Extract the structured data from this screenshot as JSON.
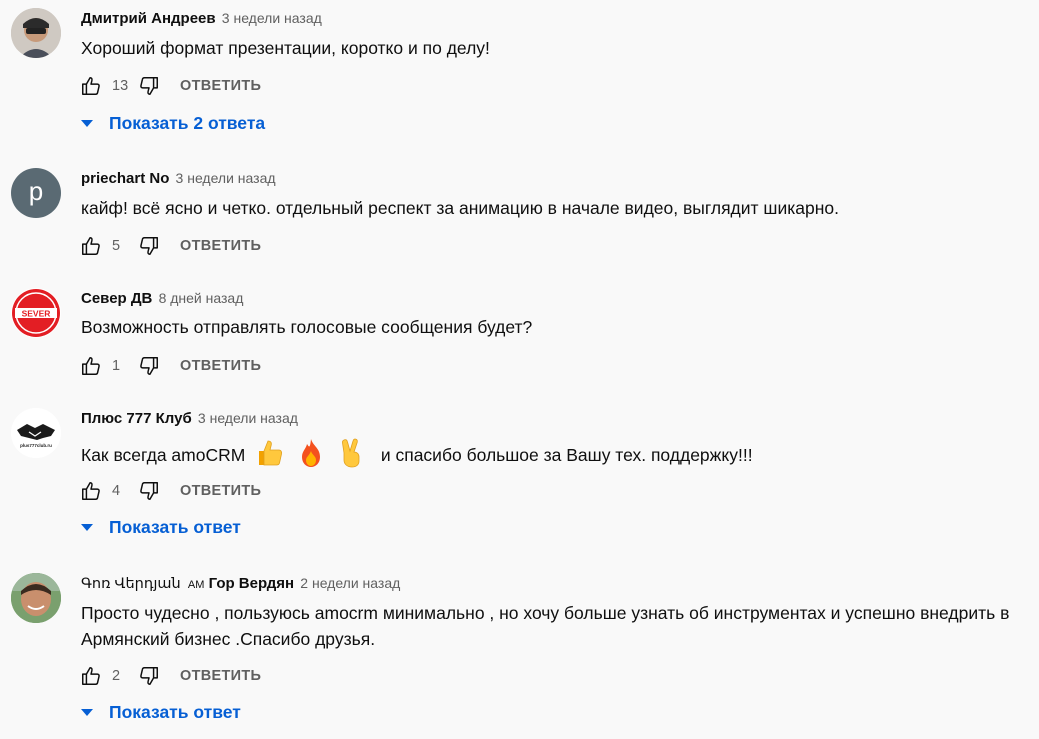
{
  "comments": [
    {
      "author": "Дмитрий Андреев",
      "time": "3 недели назад",
      "text": "Хороший формат презентации, коротко и по делу!",
      "likes": "13",
      "reply_label": "ОТВЕТИТЬ",
      "show_replies": "Показать 2 ответа",
      "avatar_icon": "person-photo-avatar"
    },
    {
      "author": "priechart No",
      "time": "3 недели назад",
      "text": "кайф! всё ясно и четко. отдельный респект за анимацию в начале видео, выглядит шикарно.",
      "likes": "5",
      "reply_label": "ОТВЕТИТЬ",
      "avatar_letter": "p",
      "avatar_color": "#5a6a73"
    },
    {
      "author": "Север ДВ",
      "time": "8 дней назад",
      "text": "Возможность отправлять голосовые сообщения будет?",
      "likes": "1",
      "reply_label": "ОТВЕТИТЬ",
      "avatar_logo_text": "SEVER"
    },
    {
      "author": "Плюс 777 Клуб",
      "time": "3 недели назад",
      "text_before": "Как всегда amoCRM",
      "text_after": "и спасибо большое за Вашу тех. поддержку!!!",
      "emojis": [
        "thumbs-up",
        "fire",
        "victory-hand"
      ],
      "likes": "4",
      "reply_label": "ОТВЕТИТЬ",
      "show_replies": "Показать ответ",
      "avatar_logo_text": "plus777club.ru"
    },
    {
      "author_prefix": "Գոռ Վերդյան",
      "author_am": "AM",
      "author": "Гор Вердян",
      "time": "2 недели назад",
      "text": "Просто чудесно , пользуюсь amocrm  минимально , но хочу больше узнать об инструментах и успешно внедрить в Армянский бизнес .Спасибо друзья.",
      "likes": "2",
      "reply_label": "ОТВЕТИТЬ",
      "show_replies": "Показать ответ"
    }
  ],
  "colors": {
    "background": "#f9f9f9",
    "link": "#065fd4",
    "secondary": "#606060"
  }
}
